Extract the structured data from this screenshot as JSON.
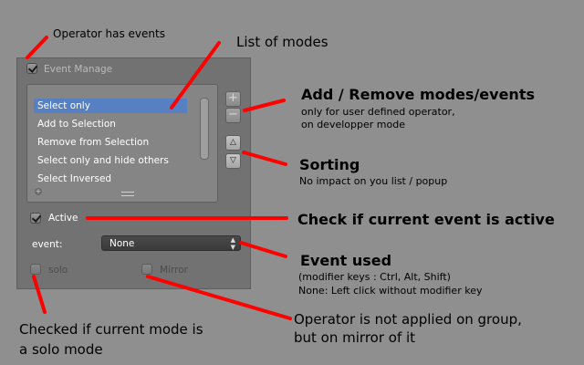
{
  "panel": {
    "title": "Event Manage",
    "modes": [
      "Select only",
      "Add to Selection",
      "Remove from Selection",
      "Select only and hide others",
      "Select Inversed"
    ],
    "selected_index": 0,
    "add_icon": "plus-icon",
    "remove_icon": "minus-icon",
    "up_icon": "triangle-up-icon",
    "down_icon": "triangle-down-icon",
    "active_label": "Active",
    "active_checked": true,
    "event_label": "event:",
    "event_value": "None",
    "solo_label": "solo",
    "mirror_label": "Mirror"
  },
  "annotations": {
    "operator_events": "Operator has events",
    "list_of_modes": "List of modes",
    "add_remove_title": "Add / Remove modes/events",
    "add_remove_line1": "only for user defined operator,",
    "add_remove_line2": "on developper mode",
    "sorting_title": "Sorting",
    "sorting_sub": "No impact on you list / popup",
    "active_note": "Check if current event is active",
    "event_used_title": "Event used",
    "event_used_line1": "(modifier keys : Ctrl, Alt, Shift)",
    "event_used_line2": "None: Left click without modifier key",
    "solo_line1": "Checked if current mode is",
    "solo_line2": "a solo mode",
    "mirror_line1": "Operator is not applied on group,",
    "mirror_line2": "but on mirror of it"
  },
  "colors": {
    "background": "#8f8f8f",
    "selection": "#5680c2",
    "arrow": "#ff0000"
  }
}
